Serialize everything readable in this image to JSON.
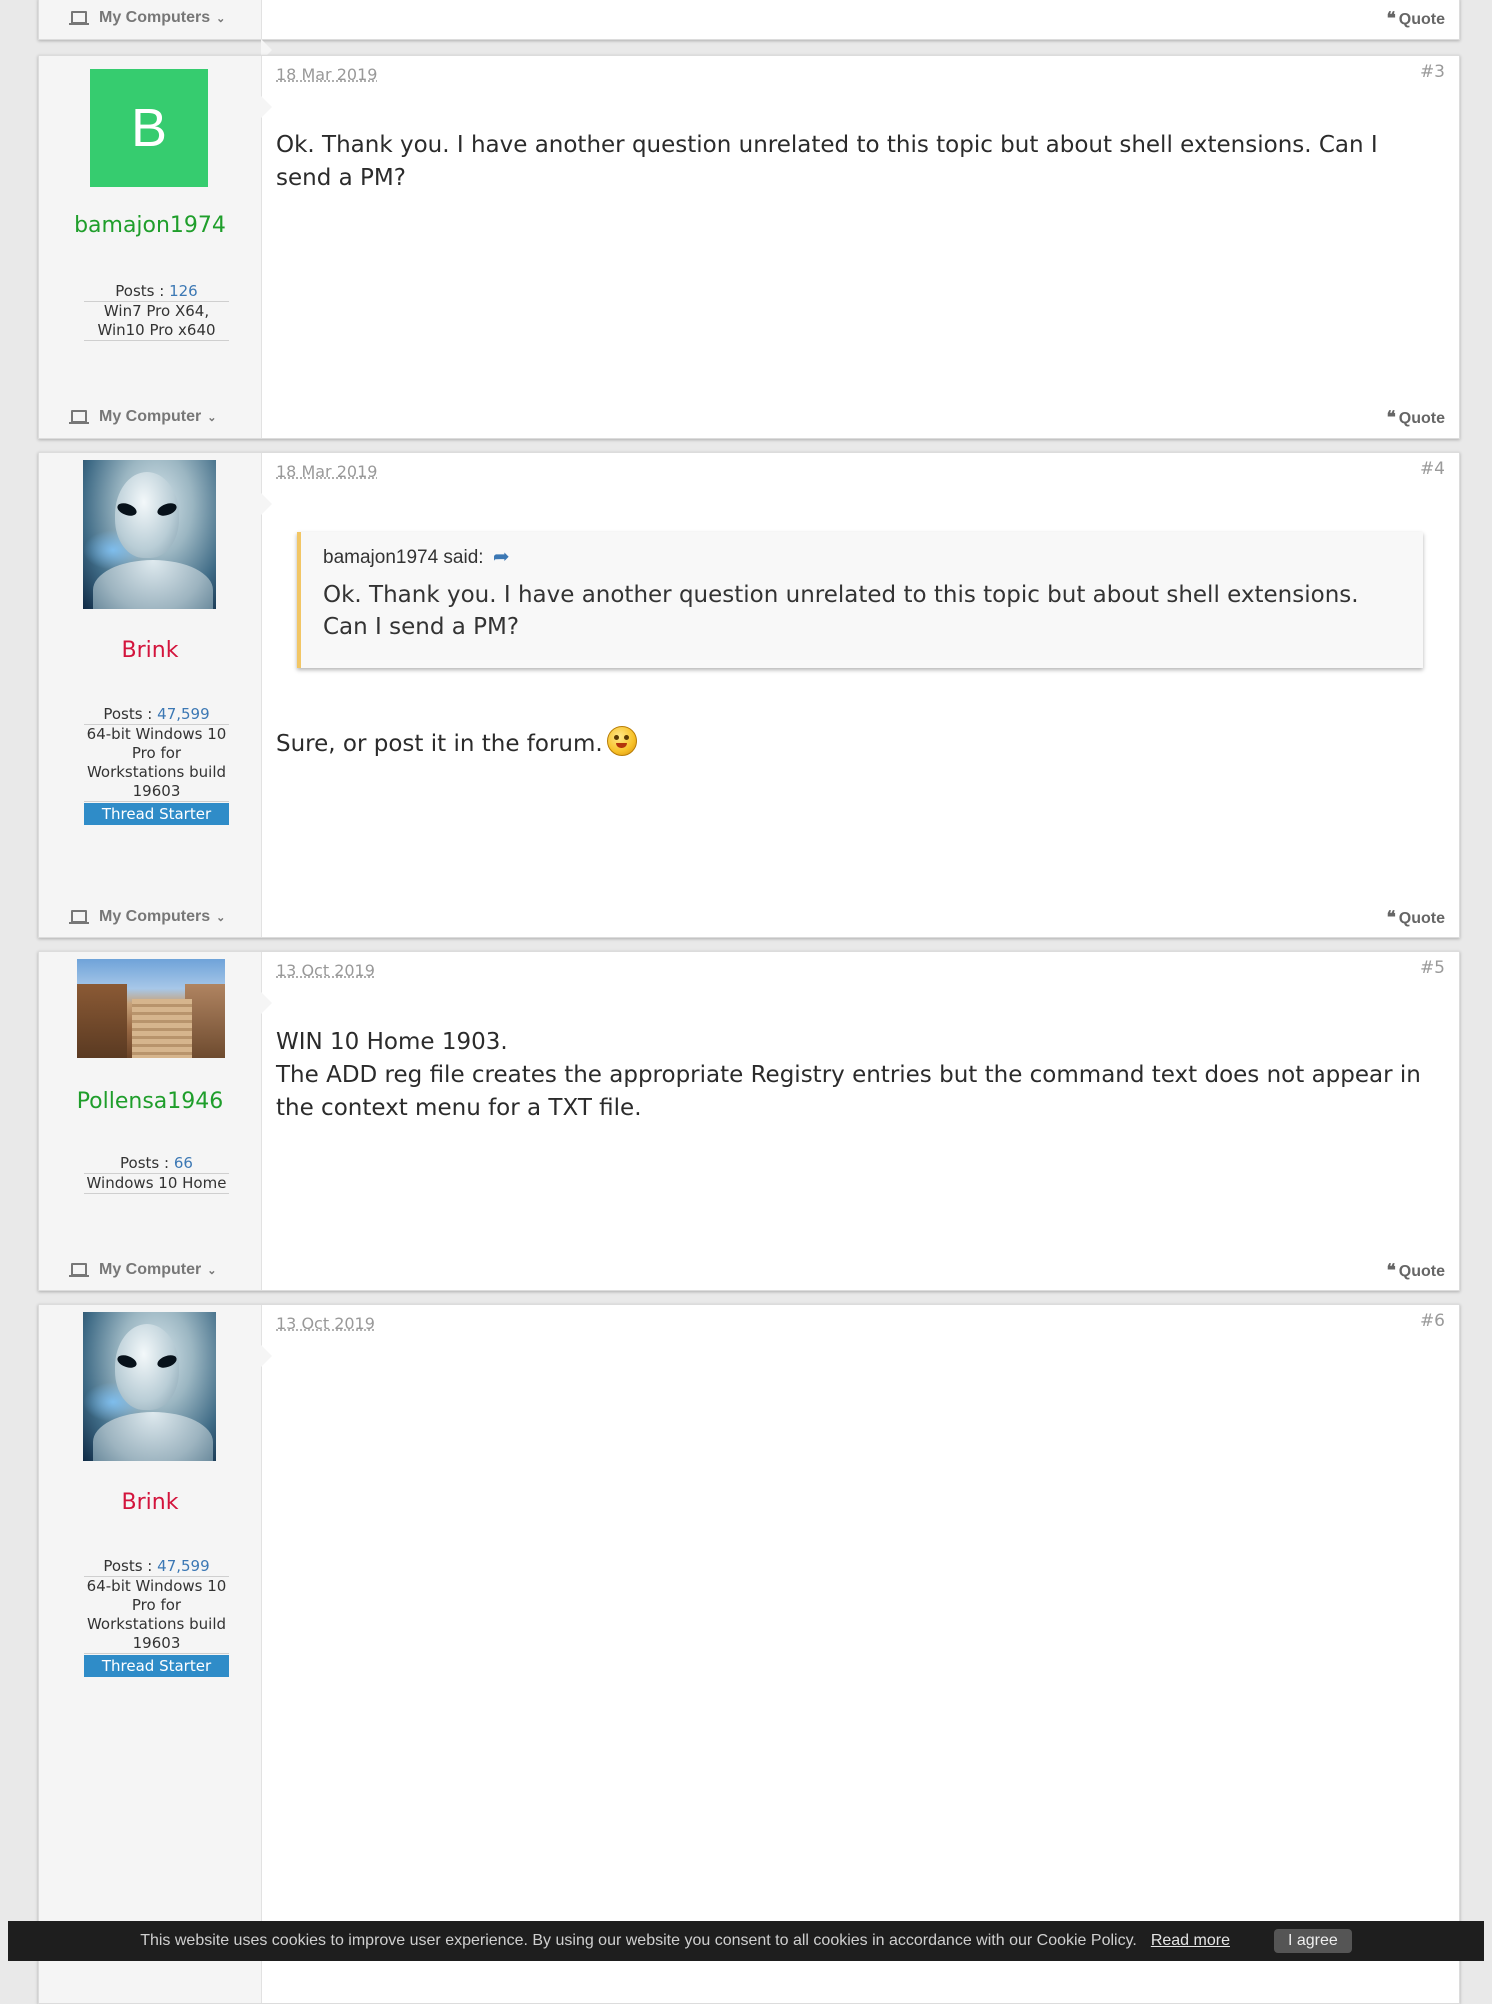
{
  "top_footer": {
    "my_computer_label": "My Computers",
    "quote_label": "Quote"
  },
  "posts": [
    {
      "username": "bamajon1974",
      "avatar_letter": "B",
      "posts_label": "Posts :",
      "posts_count": "126",
      "system": "Win7 Pro X64, Win10 Pro x640",
      "date": "18 Mar 2019",
      "number": "#3",
      "body": "Ok. Thank you. I have another question unrelated to this topic but about shell extensions. Can I send a PM?",
      "my_computer_label": "My Computer",
      "quote_label": "Quote"
    },
    {
      "username": "Brink",
      "posts_label": "Posts :",
      "posts_count": "47,599",
      "system": "64-bit Windows 10 Pro for Workstations build 19603",
      "badge": "Thread Starter",
      "date": "18 Mar 2019",
      "number": "#4",
      "quote_author": "bamajon1974 said:",
      "quote_text": "Ok. Thank you. I have another question unrelated to this topic but about shell extensions. Can I send a PM?",
      "body": "Sure, or post it in the forum.",
      "my_computer_label": "My Computers",
      "quote_label": "Quote"
    },
    {
      "username": "Pollensa1946",
      "posts_label": "Posts :",
      "posts_count": "66",
      "system": "Windows 10 Home",
      "date": "13 Oct 2019",
      "number": "#5",
      "body_line1": "WIN 10 Home 1903.",
      "body_line2": "The ADD reg file creates the appropriate Registry entries but the command text does not appear in the context menu for a TXT file.",
      "my_computer_label": "My Computer",
      "quote_label": "Quote"
    },
    {
      "username": "Brink",
      "posts_label": "Posts :",
      "posts_count": "47,599",
      "system": "64-bit Windows 10 Pro for Workstations build 19603",
      "badge": "Thread Starter",
      "date": "13 Oct 2019",
      "number": "#6"
    }
  ],
  "cookie": {
    "text": "This website uses cookies to improve user experience. By using our website you consent to all cookies in accordance with our Cookie Policy.",
    "read_more": "Read more",
    "agree": "I agree"
  },
  "colors": {
    "username_green": "#1f9e2b",
    "username_red": "#d3143c",
    "badge_blue": "#2f8cc8",
    "avatar_green": "#36cc6f",
    "quote_border": "#f2c665"
  }
}
